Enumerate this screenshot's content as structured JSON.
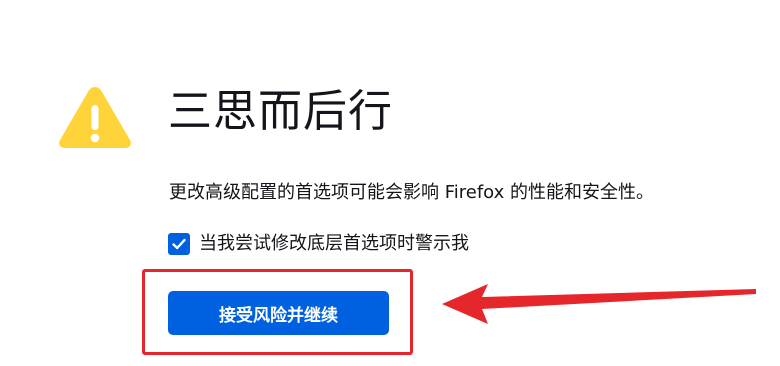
{
  "dialog": {
    "title": "三思而后行",
    "description": "更改高级配置的首选项可能会影响 Firefox 的性能和安全性。",
    "warn_checkbox": {
      "label": "当我尝试修改底层首选项时警示我",
      "checked": true
    },
    "accept_button_label": "接受风险并继续"
  },
  "icons": {
    "warning": "warning-icon",
    "checkmark": "checkmark-icon"
  },
  "colors": {
    "warning_yellow": "#ffd43b",
    "primary_blue": "#0061e0",
    "annotation_red": "#e5262a",
    "text": "#15141a"
  }
}
